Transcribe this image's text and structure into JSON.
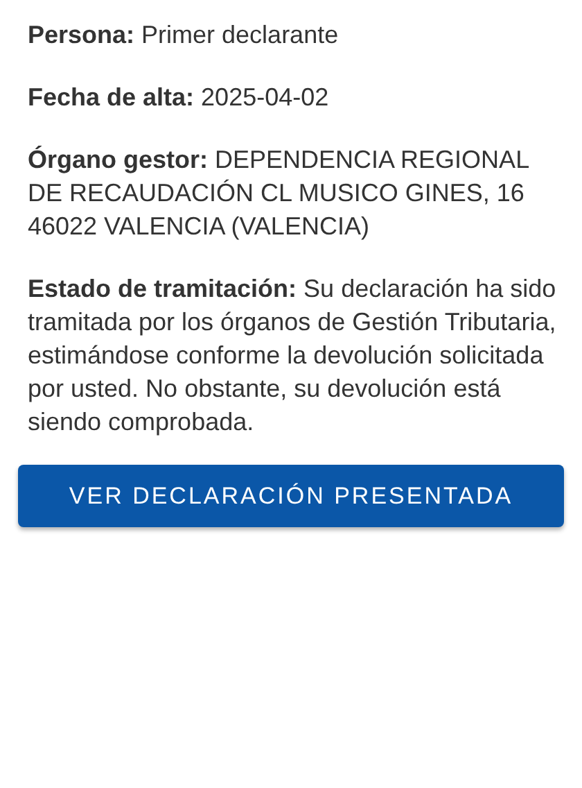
{
  "fields": [
    {
      "text": "**Persona:** Primer declarante"
    },
    {
      "text": "**Fecha de alta:** 2025-04-02"
    },
    {
      "text": "**Órgano gestor:** DEPENDENCIA REGIONAL DE RECAUDACIÓN CL MUSICO GINES, 16\n46022 VALENCIA (VALENCIA)"
    },
    {
      "text": "**Estado de tramitación:** Su declaración ha sido tramitada por los órganos de Gestión Tributaria, estimándose conforme la devolución solicitada por usted. No obstante, su devolución está siendo comprobada."
    }
  ],
  "button": {
    "label": "VER DECLARACIÓN PRESENTADA"
  }
}
